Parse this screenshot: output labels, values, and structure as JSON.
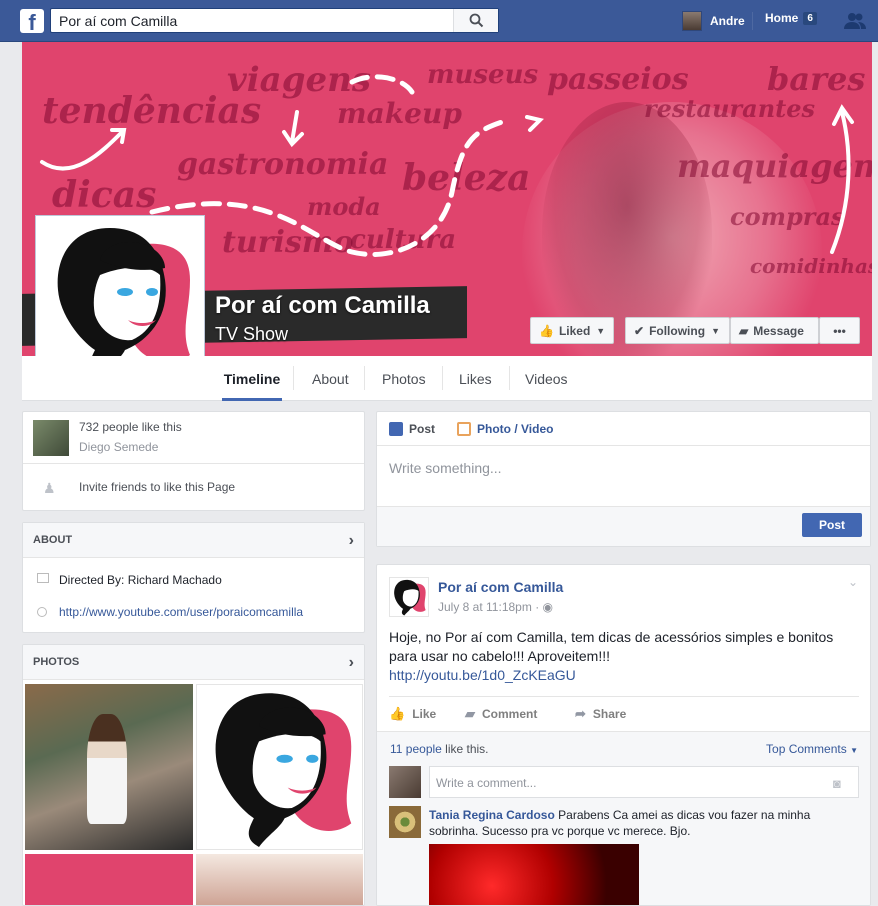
{
  "topbar": {
    "logo": "f",
    "search_value": "Por aí com Camilla",
    "user_name": "Andre",
    "home_label": "Home",
    "home_count": "6"
  },
  "cover": {
    "words": [
      "tendências",
      "viagens",
      "museus",
      "passeios",
      "bares",
      "restaurantes",
      "makeup",
      "gastronomia",
      "beleza",
      "maquiagem",
      "dicas",
      "moda",
      "compras",
      "turismo",
      "cultura",
      "comidinhas"
    ],
    "accent_color": "#e0446d"
  },
  "page": {
    "title": "Por aí com Camilla",
    "category": "TV Show",
    "liked_label": "Liked",
    "following_label": "Following",
    "message_label": "Message",
    "more_label": "•••"
  },
  "tabs": [
    {
      "label": "Timeline"
    },
    {
      "label": "About"
    },
    {
      "label": "Photos"
    },
    {
      "label": "Likes"
    },
    {
      "label": "Videos"
    }
  ],
  "likes_card": {
    "count_text": "732 people like this",
    "friend_name": "Diego Semede",
    "invite_text": "Invite friends to like this Page"
  },
  "about_card": {
    "header": "ABOUT",
    "directed": "Directed By: Richard Machado",
    "website": "http://www.youtube.com/user/poraicomcamilla"
  },
  "photos_card": {
    "header": "PHOTOS"
  },
  "composer": {
    "tab_post": "Post",
    "tab_photo": "Photo / Video",
    "placeholder": "Write something...",
    "post_button": "Post"
  },
  "post": {
    "author": "Por aí com Camilla",
    "time": "July 8 at 11:18pm",
    "text": "Hoje, no Por aí com Camilla, tem dicas de acessórios simples e bonitos para usar no cabelo!!! Aproveitem!!!",
    "link": "http://youtu.be/1d0_ZcKEaGU",
    "like_label": "Like",
    "comment_label": "Comment",
    "share_label": "Share",
    "likes_count": "11 people",
    "likes_suffix": " like this.",
    "top_comments": "Top Comments",
    "comment_placeholder": "Write a comment...",
    "comment_author": "Tania Regina Cardoso",
    "comment_text": " Parabens Ca amei as dicas vou fazer na minha sobrinha. Sucesso pra vc porque vc merece. Bjo."
  }
}
